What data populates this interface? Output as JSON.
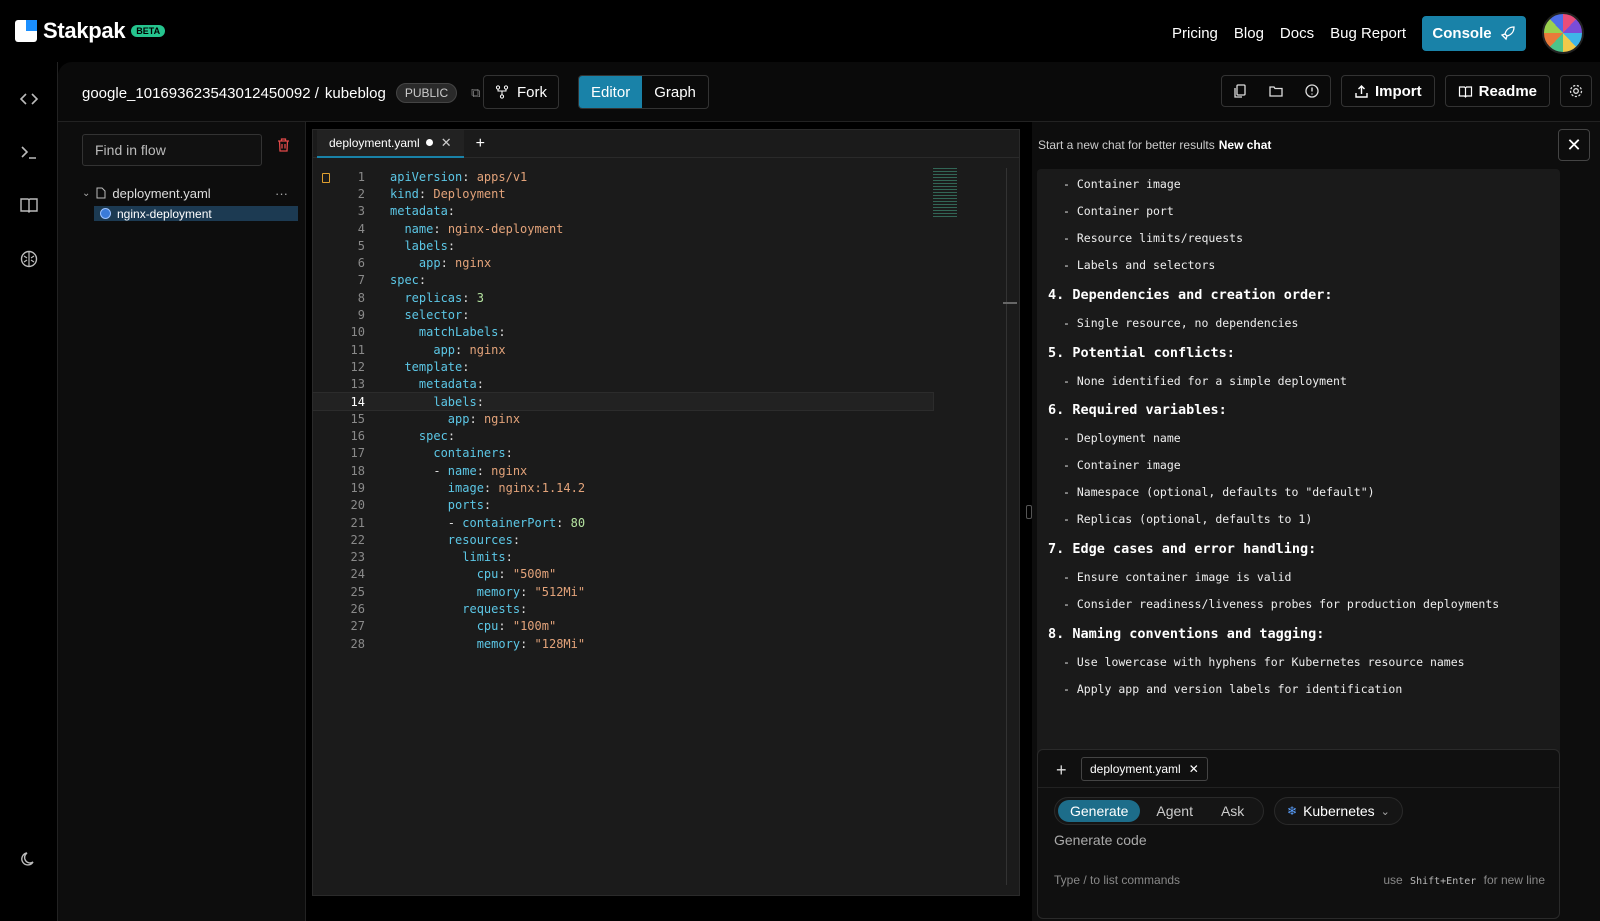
{
  "header": {
    "brand": "Stakpak",
    "badge": "BETA",
    "nav": [
      "Pricing",
      "Blog",
      "Docs",
      "Bug Report"
    ],
    "console_label": "Console",
    "brand_color": "#1982a8"
  },
  "rail": {
    "icons": [
      "code-icon",
      "terminal-icon",
      "book-icon",
      "brain-icon",
      "moon-icon"
    ]
  },
  "project": {
    "owner": "google_101693623543012450092 /",
    "name": "kubeblog",
    "visibility": "PUBLIC",
    "fork_label": "Fork",
    "view_tabs": [
      "Editor",
      "Graph"
    ],
    "active_view": "Editor",
    "import_label": "Import",
    "readme_label": "Readme"
  },
  "files": {
    "search_placeholder": "Find in flow",
    "file": "deployment.yaml",
    "child": "nginx-deployment",
    "more": "···"
  },
  "editor": {
    "tab": "deployment.yaml",
    "current_line": 14,
    "lines": [
      [
        [
          "k",
          "apiVersion"
        ],
        [
          "p",
          ": "
        ],
        [
          "v",
          "apps/v1"
        ]
      ],
      [
        [
          "k",
          "kind"
        ],
        [
          "p",
          ": "
        ],
        [
          "v",
          "Deployment"
        ]
      ],
      [
        [
          "k",
          "metadata"
        ],
        [
          "p",
          ":"
        ]
      ],
      [
        [
          "p",
          "  "
        ],
        [
          "k",
          "name"
        ],
        [
          "p",
          ": "
        ],
        [
          "v",
          "nginx-deployment"
        ]
      ],
      [
        [
          "p",
          "  "
        ],
        [
          "k",
          "labels"
        ],
        [
          "p",
          ":"
        ]
      ],
      [
        [
          "p",
          "    "
        ],
        [
          "k",
          "app"
        ],
        [
          "p",
          ": "
        ],
        [
          "v",
          "nginx"
        ]
      ],
      [
        [
          "k",
          "spec"
        ],
        [
          "p",
          ":"
        ]
      ],
      [
        [
          "p",
          "  "
        ],
        [
          "k",
          "replicas"
        ],
        [
          "p",
          ": "
        ],
        [
          "n",
          "3"
        ]
      ],
      [
        [
          "p",
          "  "
        ],
        [
          "k",
          "selector"
        ],
        [
          "p",
          ":"
        ]
      ],
      [
        [
          "p",
          "    "
        ],
        [
          "k",
          "matchLabels"
        ],
        [
          "p",
          ":"
        ]
      ],
      [
        [
          "p",
          "      "
        ],
        [
          "k",
          "app"
        ],
        [
          "p",
          ": "
        ],
        [
          "v",
          "nginx"
        ]
      ],
      [
        [
          "p",
          "  "
        ],
        [
          "k",
          "template"
        ],
        [
          "p",
          ":"
        ]
      ],
      [
        [
          "p",
          "    "
        ],
        [
          "k",
          "metadata"
        ],
        [
          "p",
          ":"
        ]
      ],
      [
        [
          "p",
          "      "
        ],
        [
          "k",
          "labels"
        ],
        [
          "p",
          ":"
        ]
      ],
      [
        [
          "p",
          "        "
        ],
        [
          "k",
          "app"
        ],
        [
          "p",
          ": "
        ],
        [
          "v",
          "nginx"
        ]
      ],
      [
        [
          "p",
          "    "
        ],
        [
          "k",
          "spec"
        ],
        [
          "p",
          ":"
        ]
      ],
      [
        [
          "p",
          "      "
        ],
        [
          "k",
          "containers"
        ],
        [
          "p",
          ":"
        ]
      ],
      [
        [
          "p",
          "      - "
        ],
        [
          "k",
          "name"
        ],
        [
          "p",
          ": "
        ],
        [
          "v",
          "nginx"
        ]
      ],
      [
        [
          "p",
          "        "
        ],
        [
          "k",
          "image"
        ],
        [
          "p",
          ": "
        ],
        [
          "v",
          "nginx:1.14.2"
        ]
      ],
      [
        [
          "p",
          "        "
        ],
        [
          "k",
          "ports"
        ],
        [
          "p",
          ":"
        ]
      ],
      [
        [
          "p",
          "        - "
        ],
        [
          "k",
          "containerPort"
        ],
        [
          "p",
          ": "
        ],
        [
          "n",
          "80"
        ]
      ],
      [
        [
          "p",
          "        "
        ],
        [
          "k",
          "resources"
        ],
        [
          "p",
          ":"
        ]
      ],
      [
        [
          "p",
          "          "
        ],
        [
          "k",
          "limits"
        ],
        [
          "p",
          ":"
        ]
      ],
      [
        [
          "p",
          "            "
        ],
        [
          "k",
          "cpu"
        ],
        [
          "p",
          ": "
        ],
        [
          "v",
          "\"500m\""
        ]
      ],
      [
        [
          "p",
          "            "
        ],
        [
          "k",
          "memory"
        ],
        [
          "p",
          ": "
        ],
        [
          "v",
          "\"512Mi\""
        ]
      ],
      [
        [
          "p",
          "          "
        ],
        [
          "k",
          "requests"
        ],
        [
          "p",
          ":"
        ]
      ],
      [
        [
          "p",
          "            "
        ],
        [
          "k",
          "cpu"
        ],
        [
          "p",
          ": "
        ],
        [
          "v",
          "\"100m\""
        ]
      ],
      [
        [
          "p",
          "            "
        ],
        [
          "k",
          "memory"
        ],
        [
          "p",
          ": "
        ],
        [
          "v",
          "\"128Mi\""
        ]
      ]
    ]
  },
  "chat": {
    "hint": "Start a new chat for better results",
    "new_chat": "New chat",
    "items": [
      {
        "t": "item",
        "text": "- Container image"
      },
      {
        "t": "item",
        "text": "- Container port"
      },
      {
        "t": "item",
        "text": "- Resource limits/requests"
      },
      {
        "t": "item",
        "text": "- Labels and selectors"
      },
      {
        "t": "head",
        "text": "4. Dependencies and creation order:"
      },
      {
        "t": "item",
        "text": "- Single resource, no dependencies"
      },
      {
        "t": "head",
        "text": "5. Potential conflicts:"
      },
      {
        "t": "item",
        "text": "- None identified for a simple deployment"
      },
      {
        "t": "head",
        "text": "6. Required variables:"
      },
      {
        "t": "item",
        "text": "- Deployment name"
      },
      {
        "t": "item",
        "text": "- Container image"
      },
      {
        "t": "item",
        "text": "- Namespace (optional, defaults to \"default\")"
      },
      {
        "t": "item",
        "text": "- Replicas (optional, defaults to 1)"
      },
      {
        "t": "head",
        "text": "7. Edge cases and error handling:"
      },
      {
        "t": "item",
        "text": "- Ensure container image is valid"
      },
      {
        "t": "item",
        "text": "- Consider readiness/liveness probes for production deployments"
      },
      {
        "t": "head",
        "text": "8. Naming conventions and tagging:"
      },
      {
        "t": "item",
        "text": "- Use lowercase with hyphens for Kubernetes resource names"
      },
      {
        "t": "item",
        "text": "- Apply app and version labels for identification"
      }
    ]
  },
  "composer": {
    "context_chip": "deployment.yaml",
    "modes": [
      "Generate",
      "Agent",
      "Ask"
    ],
    "active_mode": "Generate",
    "platform": "Kubernetes",
    "placeholder": "Generate code",
    "hint_left": "Type  /  to list commands",
    "hint_use": "use",
    "hint_key": "Shift+Enter",
    "hint_right": "for new line"
  }
}
